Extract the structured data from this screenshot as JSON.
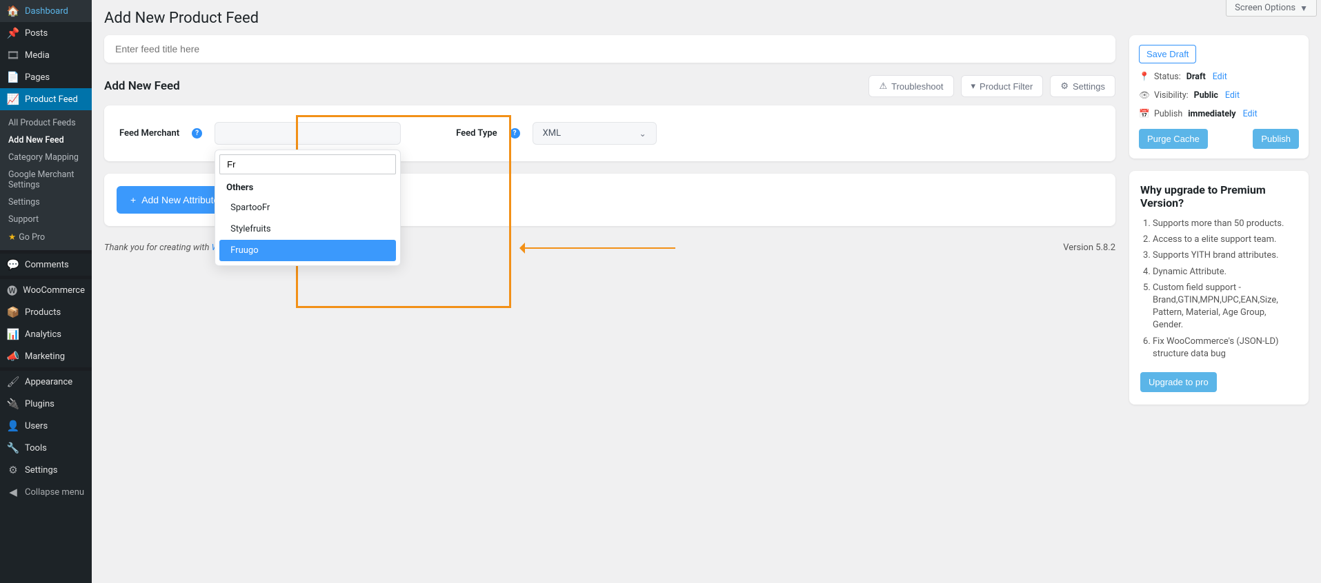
{
  "screen_options": "Screen Options",
  "page_title": "Add New Product Feed",
  "title_placeholder": "Enter feed title here",
  "section_heading": "Add New Feed",
  "toolbar": {
    "troubleshoot": "Troubleshoot",
    "product_filter": "Product Filter",
    "settings": "Settings"
  },
  "config": {
    "merchant_label": "Feed Merchant",
    "merchant_search_value": "Fr",
    "merchant_group": "Others",
    "merchant_options": [
      "SpartooFr",
      "Stylefruits",
      "Fruugo"
    ],
    "feedtype_label": "Feed Type",
    "feedtype_value": "XML"
  },
  "add_attribute": "Add New Attribute",
  "sidebar": [
    {
      "label": "Dashboard",
      "icon": "speedometer"
    },
    {
      "label": "Posts",
      "icon": "pin"
    },
    {
      "label": "Media",
      "icon": "media"
    },
    {
      "label": "Pages",
      "icon": "page"
    },
    {
      "label": "Product Feed",
      "icon": "chart",
      "active": true
    },
    {
      "label": "Comments",
      "icon": "comment"
    },
    {
      "label": "WooCommerce",
      "icon": "woo"
    },
    {
      "label": "Products",
      "icon": "box"
    },
    {
      "label": "Analytics",
      "icon": "bars"
    },
    {
      "label": "Marketing",
      "icon": "mega"
    },
    {
      "label": "Appearance",
      "icon": "brush"
    },
    {
      "label": "Plugins",
      "icon": "plug"
    },
    {
      "label": "Users",
      "icon": "user"
    },
    {
      "label": "Tools",
      "icon": "wrench"
    },
    {
      "label": "Settings",
      "icon": "sliders"
    },
    {
      "label": "Collapse menu",
      "icon": "collapse",
      "collapse": true
    }
  ],
  "submenu": [
    {
      "label": "All Product Feeds"
    },
    {
      "label": "Add New Feed",
      "current": true
    },
    {
      "label": "Category Mapping"
    },
    {
      "label": "Google Merchant Settings"
    },
    {
      "label": "Settings"
    },
    {
      "label": "Support"
    },
    {
      "label": "Go Pro",
      "star": true
    }
  ],
  "publish": {
    "save_draft": "Save Draft",
    "status_label": "Status:",
    "status_value": "Draft",
    "visibility_label": "Visibility:",
    "visibility_value": "Public",
    "schedule_label": "Publish",
    "schedule_value": "immediately",
    "edit": "Edit",
    "purge": "Purge Cache",
    "publish": "Publish"
  },
  "upgrade": {
    "heading": "Why upgrade to Premium Version?",
    "items": [
      "Supports more than 50 products.",
      "Access to a elite support team.",
      "Supports YITH brand attributes.",
      "Dynamic Attribute.",
      "Custom field support - Brand,GTIN,MPN,UPC,EAN,Size, Pattern, Material, Age Group, Gender.",
      "Fix WooCommerce's (JSON-LD) structure data bug"
    ],
    "cta": "Upgrade to pro"
  },
  "footer": {
    "thanks_prefix": "Thank you for creating with ",
    "wp": "WordPress",
    "version": "Version 5.8.2"
  }
}
